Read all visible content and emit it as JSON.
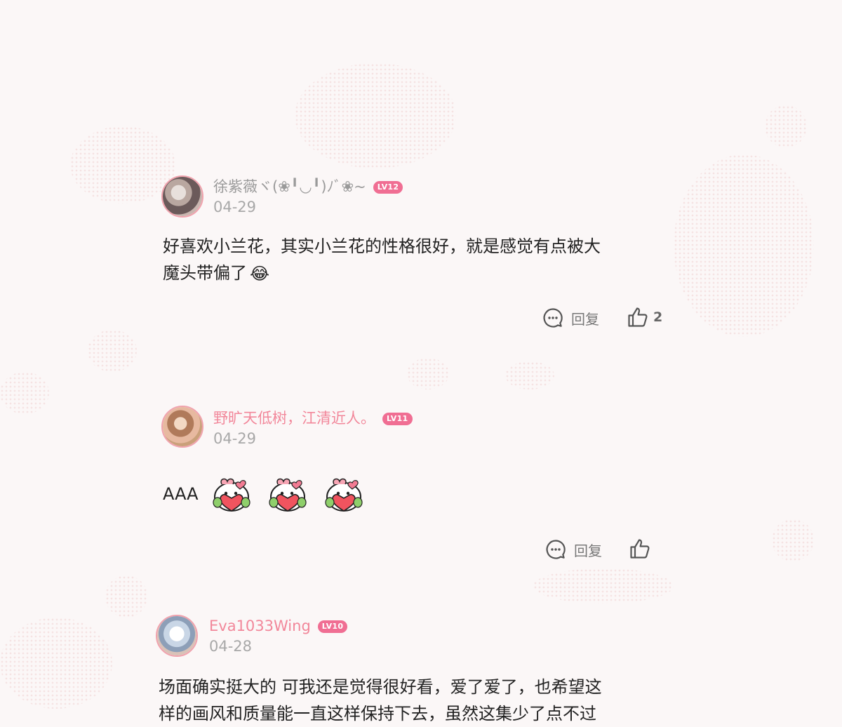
{
  "comments": [
    {
      "username": "徐紫薇ヾ(❀╹◡╹)ﾉﾞ❀~",
      "level": "LV12",
      "date": "04-29",
      "text_line1": "好喜欢小兰花，其实小兰花的性格很好，就是感觉有点被大",
      "text_line2": "魔头带偏了",
      "emoji": "😂",
      "reply_label": "回复",
      "like_count": "2"
    },
    {
      "username": "野旷天低树，江清近人。",
      "level": "LV11",
      "date": "04-29",
      "text": "AAA",
      "reply_label": "回复"
    },
    {
      "username": "Eva1033Wing",
      "level": "LV10",
      "date": "04-28",
      "text_line1": "场面确实挺大的 可我还是觉得很好看，爱了爱了，也希望这",
      "text_line2": "样的画风和质量能一直这样保持下去，虽然这集少了点不过"
    }
  ],
  "colors": {
    "badge": "#f06e93",
    "username_pink": "#f2879a",
    "avatar_ring": "#f0a2ad"
  },
  "icons": [
    "reply-icon",
    "like-icon",
    "heart-sticker"
  ]
}
